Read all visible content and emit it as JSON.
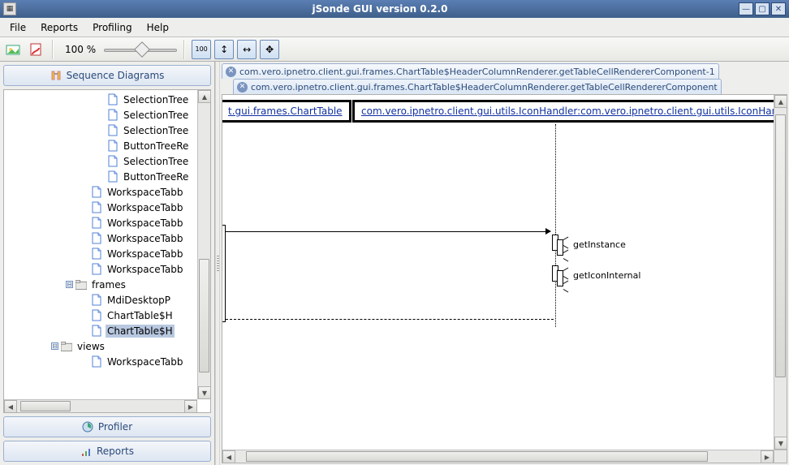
{
  "window": {
    "title": "jSonde GUI version 0.2.0"
  },
  "menu": {
    "file": "File",
    "reports": "Reports",
    "profiling": "Profiling",
    "help": "Help"
  },
  "toolbar": {
    "zoom": "100 %",
    "mode100": "100"
  },
  "sidebar": {
    "sequence": "Sequence Diagrams",
    "profiler": "Profiler",
    "reports": "Reports"
  },
  "tree": {
    "items": [
      {
        "indent": 110,
        "type": "file",
        "label": "SelectionTree"
      },
      {
        "indent": 110,
        "type": "file",
        "label": "SelectionTree"
      },
      {
        "indent": 110,
        "type": "file",
        "label": "SelectionTree"
      },
      {
        "indent": 110,
        "type": "file",
        "label": "ButtonTreeRe"
      },
      {
        "indent": 110,
        "type": "file",
        "label": "SelectionTree"
      },
      {
        "indent": 110,
        "type": "file",
        "label": "ButtonTreeRe"
      },
      {
        "indent": 90,
        "type": "file",
        "label": "WorkspaceTabb"
      },
      {
        "indent": 90,
        "type": "file",
        "label": "WorkspaceTabb"
      },
      {
        "indent": 90,
        "type": "file",
        "label": "WorkspaceTabb"
      },
      {
        "indent": 90,
        "type": "file",
        "label": "WorkspaceTabb"
      },
      {
        "indent": 90,
        "type": "file",
        "label": "WorkspaceTabb"
      },
      {
        "indent": 90,
        "type": "file",
        "label": "WorkspaceTabb"
      },
      {
        "indent": 72,
        "type": "folder",
        "toggle": "open",
        "label": "frames"
      },
      {
        "indent": 90,
        "type": "file",
        "label": "MdiDesktopP"
      },
      {
        "indent": 90,
        "type": "file",
        "label": "ChartTable$H"
      },
      {
        "indent": 90,
        "type": "file",
        "label": "ChartTable$H",
        "selected": true
      },
      {
        "indent": 54,
        "type": "folder",
        "toggle": "open",
        "label": "views"
      },
      {
        "indent": 90,
        "type": "file",
        "label": "WorkspaceTabb"
      }
    ]
  },
  "tabs": {
    "t0": "com.vero.ipnetro.client.gui.frames.ChartTable$HeaderColumnRenderer.getTableCellRendererComponent-1",
    "t1": "com.vero.ipnetro.client.gui.frames.ChartTable$HeaderColumnRenderer.getTableCellRendererComponent"
  },
  "diagram": {
    "box0": "t.gui.frames.ChartTable",
    "box1": "com.vero.ipnetro.client.gui.utils.IconHandler:com.vero.ipnetro.client.gui.utils.IconHandler",
    "call0": "getInstance",
    "call1": "getIconInternal"
  }
}
